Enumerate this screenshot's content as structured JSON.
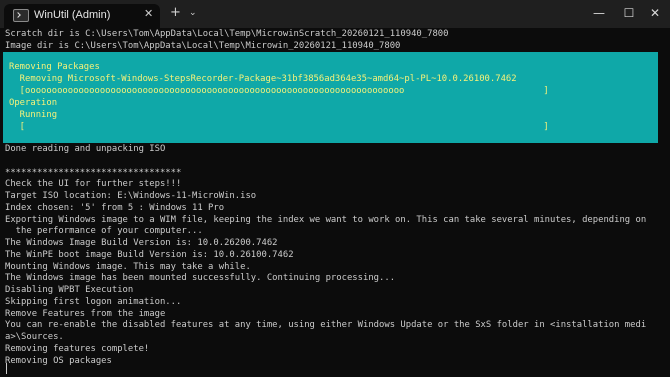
{
  "window": {
    "tab_title": "WinUtil (Admin)",
    "tab_icon": "terminal-icon",
    "close_tab": "✕",
    "new_tab": "+",
    "dropdown": "⌄",
    "minimize": "—",
    "maximize": "☐",
    "close": "✕"
  },
  "colors": {
    "background": "#0c0c0c",
    "text": "#cccccc",
    "progress_bg": "#0fa8a8",
    "progress_text": "#f6f27a"
  },
  "header_lines": [
    "Scratch dir is C:\\Users\\Tom\\AppData\\Local\\Temp\\MicrowinScratch_20260121_110940_7800",
    "Image dir is C:\\Users\\Tom\\AppData\\Local\\Temp\\Microwin_20260121_110940_7800"
  ],
  "progress": {
    "activity1": "Removing Packages",
    "status1": "  Removing Microsoft-Windows-StepsRecorder-Package~31bf3856ad364e35~amd64~pl-PL~10.0.26100.7462",
    "bar1": "  [ooooooooooooooooooooooooooooooooooooooooooooooooooooooooooooooooooooooo                          ]",
    "activity2": "Operation",
    "status2": "  Running",
    "bar2": "  [                                                                                                 ]"
  },
  "log_lines": [
    "Done reading and unpacking ISO",
    "",
    "*********************************",
    "Check the UI for further steps!!!",
    "Target ISO location: E:\\Windows-11-MicroWin.iso",
    "Index chosen: '5' from 5 : Windows 11 Pro",
    "Exporting Windows image to a WIM file, keeping the index we want to work on. This can take several minutes, depending on",
    "  the performance of your computer...",
    "The Windows Image Build Version is: 10.0.26200.7462",
    "The WinPE boot image Build Version is: 10.0.26100.7462",
    "Mounting Windows image. This may take a while.",
    "The Windows image has been mounted successfully. Continuing processing...",
    "Disabling WPBT Execution",
    "Skipping first logon animation...",
    "Remove Features from the image",
    "You can re-enable the disabled features at any time, using either Windows Update or the SxS folder in <installation medi",
    "a>\\Sources.",
    "Removing features complete!",
    "Removing OS packages"
  ]
}
